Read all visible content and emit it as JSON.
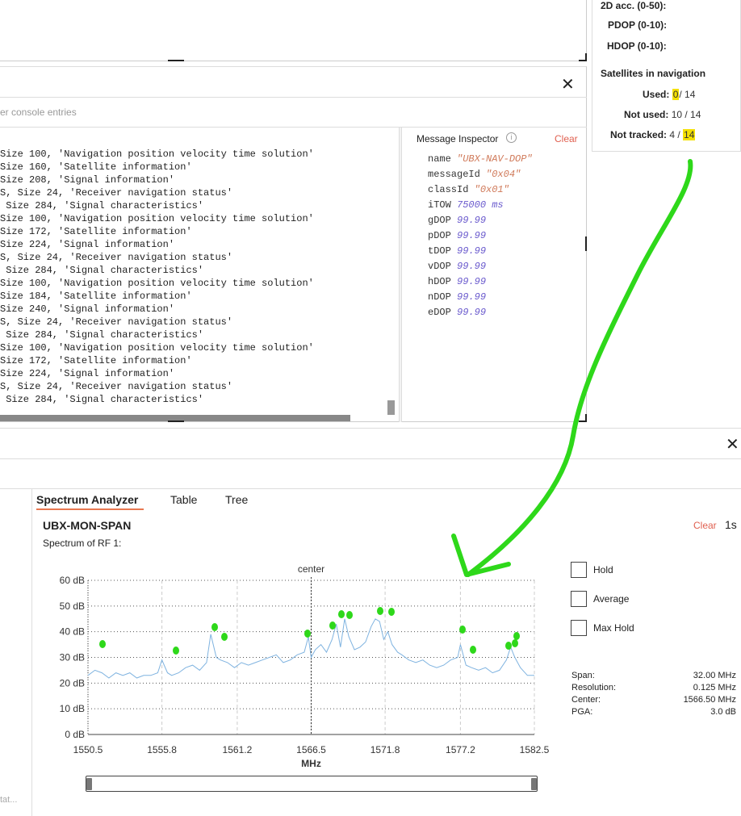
{
  "status": {
    "acc2d_label": "2D acc. (0-50):",
    "pdop_label": "PDOP (0-10):",
    "hdop_label": "HDOP (0-10):",
    "sat_title": "Satellites in navigation",
    "used_label": "Used:",
    "used_value": "0",
    "used_total": "/ 14",
    "not_used_label": "Not used:",
    "not_used_value": "10 / 14",
    "not_tracked_label": "Not tracked:",
    "not_tracked_value": "4 /",
    "not_tracked_total": "14"
  },
  "console": {
    "filter_placeholder": "er console entries",
    "lines": [
      "Size 100, 'Navigation position velocity time solution'",
      "Size 160, 'Satellite information'",
      "Size 208, 'Signal information'",
      "S, Size 24, 'Receiver navigation status'",
      " Size 284, 'Signal characteristics'",
      "Size 100, 'Navigation position velocity time solution'",
      "Size 172, 'Satellite information'",
      "Size 224, 'Signal information'",
      "S, Size 24, 'Receiver navigation status'",
      " Size 284, 'Signal characteristics'",
      "Size 100, 'Navigation position velocity time solution'",
      "Size 184, 'Satellite information'",
      "Size 240, 'Signal information'",
      "S, Size 24, 'Receiver navigation status'",
      " Size 284, 'Signal characteristics'",
      "Size 100, 'Navigation position velocity time solution'",
      "Size 172, 'Satellite information'",
      "Size 224, 'Signal information'",
      "S, Size 24, 'Receiver navigation status'",
      " Size 284, 'Signal characteristics'"
    ]
  },
  "inspector": {
    "title": "Message Inspector",
    "info": "i",
    "clear": "Clear",
    "fields": [
      {
        "key": "name",
        "value": "\"UBX-NAV-DOP\"",
        "kind": "str"
      },
      {
        "key": "messageId",
        "value": "\"0x04\"",
        "kind": "str"
      },
      {
        "key": "classId",
        "value": "\"0x01\"",
        "kind": "str"
      },
      {
        "key": "iTOW",
        "value": "75000 ms",
        "kind": "num"
      },
      {
        "key": "gDOP",
        "value": "99.99",
        "kind": "num"
      },
      {
        "key": "pDOP",
        "value": "99.99",
        "kind": "num"
      },
      {
        "key": "tDOP",
        "value": "99.99",
        "kind": "num"
      },
      {
        "key": "vDOP",
        "value": "99.99",
        "kind": "num"
      },
      {
        "key": "hDOP",
        "value": "99.99",
        "kind": "num"
      },
      {
        "key": "nDOP",
        "value": "99.99",
        "kind": "num"
      },
      {
        "key": "eDOP",
        "value": "99.99",
        "kind": "num"
      }
    ]
  },
  "spectrum": {
    "tabs": [
      "Spectrum Analyzer",
      "Table",
      "Tree"
    ],
    "title": "UBX-MON-SPAN",
    "subtitle": "Spectrum of RF 1:",
    "clear": "Clear",
    "rate": "1s",
    "left_strip_text": "tat...",
    "options": [
      "Hold",
      "Average",
      "Max Hold"
    ],
    "stats": [
      {
        "label": "Span:",
        "value": "32.00 MHz"
      },
      {
        "label": "Resolution:",
        "value": "0.125 MHz"
      },
      {
        "label": "Center:",
        "value": "1566.50 MHz"
      },
      {
        "label": "PGA:",
        "value": "3.0 dB"
      }
    ],
    "range_slider": [
      0,
      1
    ]
  },
  "colors": {
    "accent": "#e87850",
    "clear_red": "#e06050",
    "trace": "#7fb3e0",
    "annotation_green": "#2ed81a",
    "highlight": "#f4e000"
  },
  "chart_data": {
    "type": "line",
    "title": "",
    "center_label": "center",
    "xlabel": "MHz",
    "ylabel": "",
    "xlim": [
      1550.5,
      1582.5
    ],
    "ylim": [
      0,
      60
    ],
    "x_ticks": [
      "1550.5",
      "1555.8",
      "1561.2",
      "1566.5",
      "1571.8",
      "1577.2",
      "1582.5"
    ],
    "y_ticks": [
      "0 dB",
      "10 dB",
      "20 dB",
      "30 dB",
      "40 dB",
      "50 dB",
      "60 dB"
    ],
    "center_x": 1566.5,
    "grid": true,
    "series": [
      {
        "x": [
          1550.5,
          1551.0,
          1551.5,
          1552.0,
          1552.5,
          1553.0,
          1553.5,
          1554.0,
          1554.5,
          1555.0,
          1555.5,
          1555.8,
          1556.2,
          1556.5,
          1557.0,
          1557.5,
          1558.0,
          1558.5,
          1559.0,
          1559.3,
          1559.7,
          1560.0,
          1560.5,
          1561.0,
          1561.5,
          1562.0,
          1562.5,
          1563.0,
          1563.5,
          1564.0,
          1564.5,
          1565.0,
          1565.5,
          1566.0,
          1566.3,
          1566.5,
          1566.8,
          1567.2,
          1567.6,
          1568.0,
          1568.3,
          1568.6,
          1568.9,
          1569.2,
          1569.6,
          1570.0,
          1570.4,
          1570.8,
          1571.1,
          1571.4,
          1571.7,
          1572.0,
          1572.3,
          1572.7,
          1573.0,
          1573.5,
          1574.0,
          1574.5,
          1575.0,
          1575.5,
          1576.0,
          1576.5,
          1577.0,
          1577.2,
          1577.6,
          1578.0,
          1578.5,
          1579.0,
          1579.5,
          1580.0,
          1580.5,
          1580.8,
          1581.1,
          1581.5,
          1582.0,
          1582.5
        ],
        "values": [
          23,
          25,
          24,
          22,
          24,
          23,
          24,
          22,
          23,
          23,
          24,
          29,
          24,
          23,
          24,
          26,
          27,
          25,
          28,
          39,
          30,
          29,
          28,
          26,
          28,
          27,
          28,
          29,
          30,
          31,
          28,
          29,
          31,
          32,
          38,
          30,
          33,
          35,
          32,
          37,
          43,
          34,
          45,
          38,
          33,
          34,
          36,
          42,
          45,
          44,
          37,
          40,
          35,
          32,
          31,
          29,
          28,
          29,
          27,
          26,
          27,
          29,
          30,
          35,
          27,
          26,
          25,
          26,
          24,
          25,
          29,
          34,
          30,
          26,
          23,
          23
        ]
      }
    ]
  }
}
